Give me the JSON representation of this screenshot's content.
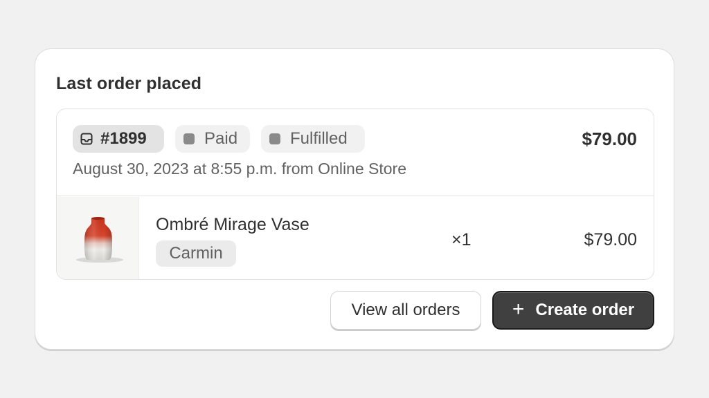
{
  "card": {
    "title": "Last order placed"
  },
  "order": {
    "number": "#1899",
    "payment_status": "Paid",
    "fulfillment_status": "Fulfilled",
    "total": "$79.00",
    "meta": "August 30, 2023 at 8:55 p.m. from Online Store"
  },
  "line_item": {
    "name": "Ombré Mirage Vase",
    "variant": "Carmin",
    "quantity": "×1",
    "price": "$79.00"
  },
  "actions": {
    "view_all_label": "View all orders",
    "create_label": "Create order"
  },
  "icons": {
    "order": "inbox-icon",
    "status": "status-dot-icon",
    "create": "plus-icon",
    "thumbnail": "vase-image"
  },
  "colors": {
    "primary_button": "#404040",
    "badge_bg": "#ebebeb",
    "status_dot": "#8a8a8a",
    "vase_red": "#c8321c"
  }
}
